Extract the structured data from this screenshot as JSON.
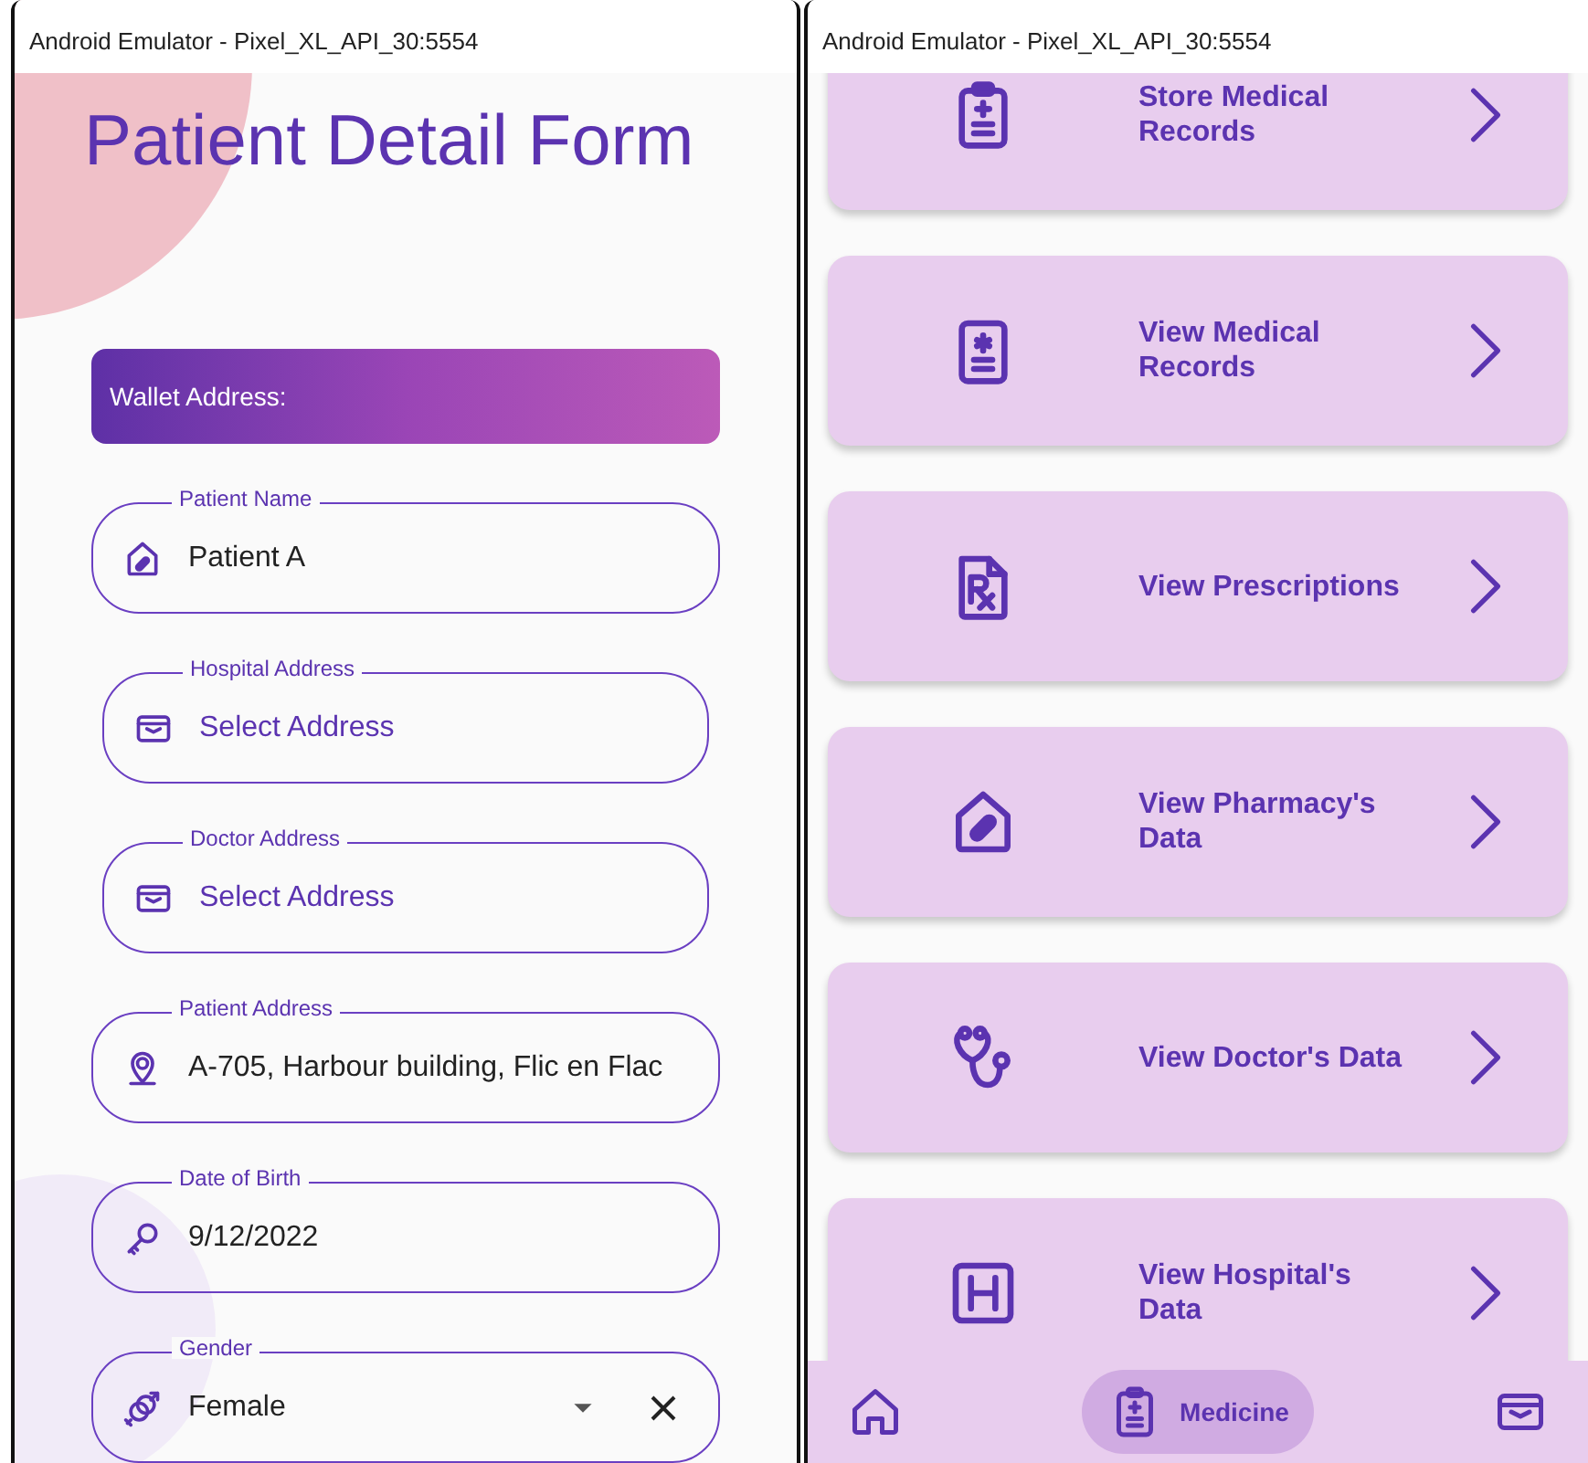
{
  "left_window": {
    "title": "Android Emulator - Pixel_XL_API_30:5554",
    "heading": "Patient Detail Form",
    "wallet_card": {
      "label": "Wallet Address:"
    },
    "fields": [
      {
        "kind": "text",
        "label": "Patient Name",
        "value": "Patient A"
      },
      {
        "kind": "select",
        "label": "Hospital Address",
        "placeholder": "Select Address"
      },
      {
        "kind": "select",
        "label": "Doctor Address",
        "placeholder": "Select Address"
      },
      {
        "kind": "text",
        "label": "Patient Address",
        "value": "A-705, Harbour building, Flic en Flac"
      },
      {
        "kind": "text",
        "label": "Date of Birth",
        "value": "9/12/2022"
      },
      {
        "kind": "dropdown",
        "label": "Gender",
        "value": "Female"
      }
    ]
  },
  "right_window": {
    "title": "Android Emulator - Pixel_XL_API_30:5554",
    "menu_cards": [
      {
        "label": "Store Medical Records"
      },
      {
        "label": "View Medical Records"
      },
      {
        "label": "View Prescriptions"
      },
      {
        "label": "View Pharmacy's Data"
      },
      {
        "label": "View Doctor's Data"
      },
      {
        "label": "View Hospital's Data"
      }
    ],
    "bottom_nav": [
      {
        "selected": false
      },
      {
        "label": "Medicine",
        "selected": true
      },
      {
        "selected": false
      }
    ]
  }
}
